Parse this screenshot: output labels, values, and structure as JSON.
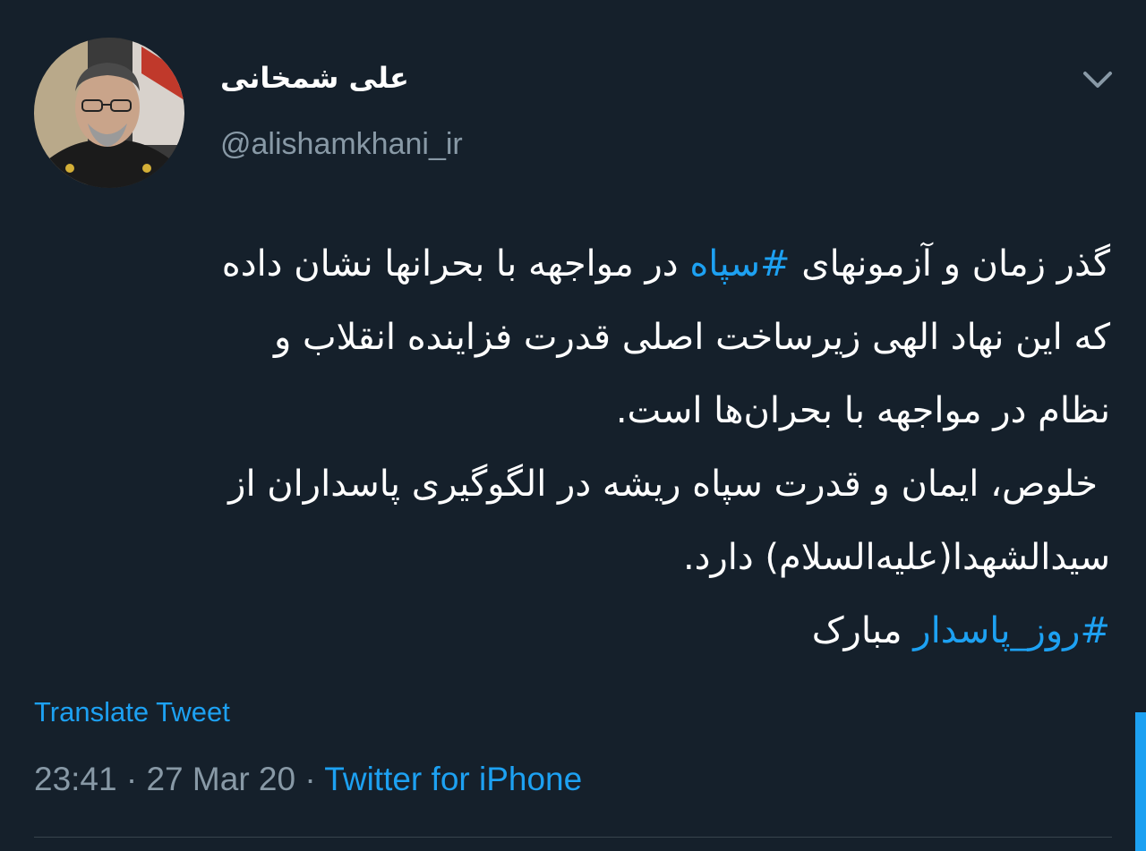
{
  "author": {
    "display_name": "علی شمخانی",
    "handle": "@alishamkhani_ir",
    "avatar_icon": "profile-photo"
  },
  "menu_icon": "chevron-down-icon",
  "tweet": {
    "line1": {
      "pre": "گذر زمان و آزمونهای ",
      "hashtag": "#سپاه",
      "post": " در مواجهه با بحرانها نشان داده"
    },
    "line2": "که این نهاد الهی زیرساخت اصلی قدرت فزاینده انقلاب و",
    "line3": "نظام در مواجهه با بحران‌ها است.",
    "line4": "خلوص، ایمان و قدرت سپاه ریشه در الگوگیری پاسداران از",
    "line5": "سیدالشهدا(علیه‌السلام) دارد.",
    "line6": {
      "hashtag": "#روز_پاسدار",
      "post": " مبارک"
    }
  },
  "translate_label": "Translate Tweet",
  "meta": {
    "time": "23:41",
    "separator": " · ",
    "date": "27 Mar 20",
    "source": "Twitter for iPhone"
  },
  "colors": {
    "background": "#15202b",
    "accent": "#1da1f2",
    "secondary_text": "#8899a6",
    "divider": "#38444d"
  }
}
